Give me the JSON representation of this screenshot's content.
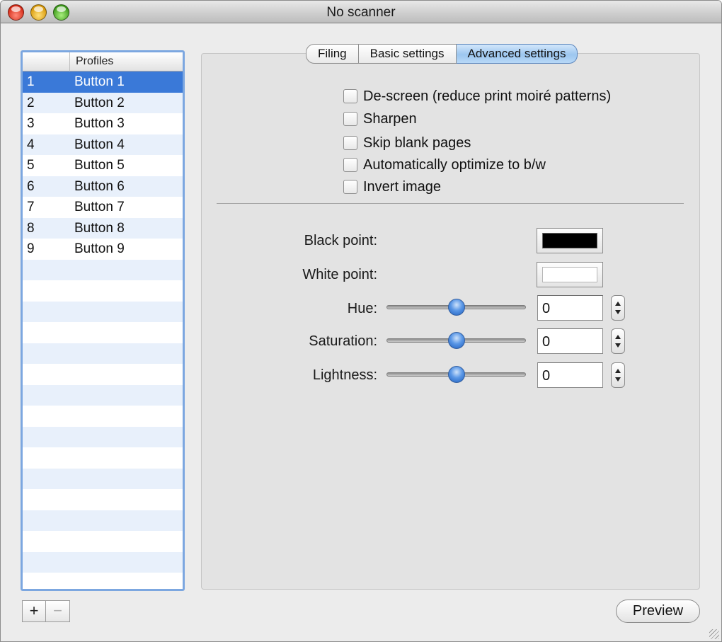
{
  "window": {
    "title": "No scanner"
  },
  "profiles": {
    "header": "Profiles",
    "rows": [
      {
        "num": "1",
        "name": "Button 1",
        "selected": true
      },
      {
        "num": "2",
        "name": "Button 2"
      },
      {
        "num": "3",
        "name": "Button 3"
      },
      {
        "num": "4",
        "name": "Button 4"
      },
      {
        "num": "5",
        "name": "Button 5"
      },
      {
        "num": "6",
        "name": "Button 6"
      },
      {
        "num": "7",
        "name": "Button 7"
      },
      {
        "num": "8",
        "name": "Button 8"
      },
      {
        "num": "9",
        "name": "Button 9"
      }
    ],
    "add_label": "+",
    "remove_label": "−"
  },
  "tabs": [
    {
      "label": "Filing"
    },
    {
      "label": "Basic settings"
    },
    {
      "label": "Advanced settings",
      "active": true
    }
  ],
  "options": [
    {
      "label": "De-screen (reduce print moiré patterns)",
      "checked": false
    },
    {
      "label": "Sharpen",
      "checked": false
    },
    {
      "label": "Skip blank pages",
      "checked": false
    },
    {
      "label": "Automatically optimize to b/w",
      "checked": false
    },
    {
      "label": "Invert image",
      "checked": false
    }
  ],
  "colors": {
    "black_point_label": "Black point:",
    "black_point_color": "#000000",
    "white_point_label": "White point:",
    "white_point_color": "#ffffff"
  },
  "adjustments": [
    {
      "label": "Hue:",
      "value": "0",
      "slider_fraction": 0.5
    },
    {
      "label": "Saturation:",
      "value": "0",
      "slider_fraction": 0.5
    },
    {
      "label": "Lightness:",
      "value": "0",
      "slider_fraction": 0.5
    }
  ],
  "preview_label": "Preview",
  "accent_color": "#3a79d8"
}
